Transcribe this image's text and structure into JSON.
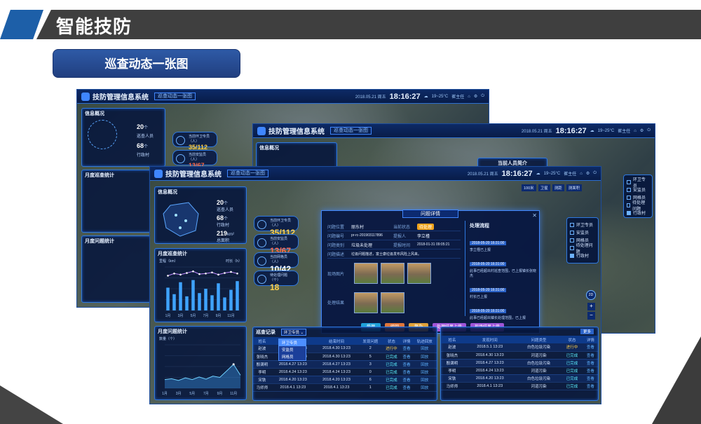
{
  "slide": {
    "title": "智能技防",
    "subtitle": "巡查动态一张图"
  },
  "app": {
    "system_title": "技防管理信息系统",
    "tag": "巡查动态一张图",
    "date": "2018.05.21 周五",
    "time": "18:16:27",
    "weather_temp": "19~25°C",
    "weather_desc": "小雨",
    "user": "崔主任"
  },
  "info_panel": {
    "title": "信息概况",
    "inspectors": "20",
    "inspectors_unit": "个",
    "inspectors_label": "巡查人员",
    "villages": "68",
    "villages_unit": "个",
    "villages_label": "行政村",
    "area": "219",
    "area_unit": "km²",
    "area_label": "总面积"
  },
  "stats": [
    {
      "label": "当前环卫专员（人）",
      "value": "35/112",
      "color": "yellow"
    },
    {
      "label": "当前安监员（人）",
      "value": "13/67",
      "color": "red"
    },
    {
      "label": "当前网格员（人）",
      "value": "10/42",
      "color": "white"
    },
    {
      "label": "待处理问题（个）",
      "value": "18",
      "color": "yellow"
    }
  ],
  "monthly_chart": {
    "title": "月度巡查统计",
    "y_left": "里程（km）",
    "y_right": "时长（h）",
    "months": [
      "1月",
      "2月",
      "3月",
      "4月",
      "5月",
      "6月"
    ]
  },
  "problem_chart": {
    "title": "月度问题统计",
    "y_label": "数量（个）",
    "y_ticks": [
      "100",
      "80",
      "60",
      "40",
      "20",
      "0"
    ]
  },
  "chart_data": [
    {
      "type": "bar",
      "title": "月度巡查统计",
      "categories": [
        "1月",
        "2月",
        "3月",
        "4月",
        "5月",
        "6月",
        "7月",
        "8月",
        "9月",
        "10月",
        "11月",
        "12月"
      ],
      "series": [
        {
          "name": "里程",
          "values": [
            210,
            150,
            260,
            130,
            280,
            160,
            200,
            140,
            250,
            120,
            190,
            270
          ]
        },
        {
          "name": "时长",
          "values": [
            320,
            340,
            330,
            345,
            360,
            335,
            340,
            350,
            330,
            345,
            355,
            340
          ]
        }
      ],
      "xlabel": "",
      "ylabel": "里程（km）",
      "ylim": [
        0,
        400
      ]
    },
    {
      "type": "area",
      "title": "月度问题统计",
      "categories": [
        "1月",
        "2月",
        "3月",
        "4月",
        "5月",
        "6月",
        "7月",
        "8月",
        "9月",
        "10月",
        "11月",
        "12月"
      ],
      "values": [
        20,
        22,
        18,
        24,
        20,
        26,
        21,
        28,
        25,
        40,
        55,
        30
      ],
      "ylabel": "数量（个）",
      "ylim": [
        0,
        100
      ]
    }
  ],
  "problem_modal": {
    "title": "问题详情",
    "fields": [
      {
        "k": "问题位置",
        "v": "丽东村",
        "k2": "当前状态",
        "v2": "待处理"
      },
      {
        "k": "问题编号",
        "v": "pr-rc-201903117896",
        "k2": "提报人",
        "v2": "李立槿"
      },
      {
        "k": "问题类别",
        "v": "垃圾未处理",
        "k2": "提报时间",
        "v2": "2018-01-31 09:05:21"
      },
      {
        "k": "问题描述",
        "v": "垃圾问题描述，富士康垃圾发布风险上风来。",
        "k2": "",
        "v2": ""
      }
    ],
    "photos_label": "现场图片",
    "result_label": "处理结果",
    "flow_title": "处理流程",
    "flow": [
      {
        "time": "2018-05-20 16:31:00",
        "text": "李立槿已上报"
      },
      {
        "time": "2018-05-20 16:31:00",
        "text": "此事已经超出村巡查范围，已上报镇长张晓杰"
      },
      {
        "time": "2018-05-20 16:31:00",
        "text": "村长已上报"
      },
      {
        "time": "2018-05-20 16:31:00",
        "text": "此事已经超出镇长处理范围，已上报"
      }
    ],
    "buttons": [
      "受理",
      "驳回",
      "督办",
      "处理结果上传",
      "现场结果上传"
    ]
  },
  "patrol_table": {
    "title": "巡查记录",
    "dropdown": "环卫专员",
    "dropdown_options": [
      "环卫专员",
      "安监员",
      "网格员"
    ],
    "headers": [
      "姓名",
      "开始时间",
      "结束时间",
      "发现问题",
      "状态",
      "详情",
      "轨迹回放"
    ],
    "rows": [
      [
        "赵波",
        "2018.4.30 13:23",
        "2018.4.30 13:23",
        "2",
        "进行中",
        "查看",
        "回放"
      ],
      [
        "张晓杰",
        "2018.4.30 13:23",
        "2018.4.30 13:23",
        "5",
        "已完成",
        "查看",
        "回放"
      ],
      [
        "殷满明",
        "2018.4.27 13:23",
        "2018.4.27 13:23",
        "3",
        "已完成",
        "查看",
        "回放"
      ],
      [
        "李明",
        "2018.4.24 13:23",
        "2018.4.24 13:23",
        "0",
        "已完成",
        "查看",
        "回放"
      ],
      [
        "宋铁",
        "2018.4.20 13:23",
        "2018.4.20 13:23",
        "6",
        "已完成",
        "查看",
        "回放"
      ],
      [
        "马师师",
        "2018.4.1 13:23",
        "2018.4.1 13:23",
        "1",
        "已完成",
        "查看",
        "回放"
      ]
    ]
  },
  "issue_table": {
    "more": "更多",
    "headers": [
      "姓名",
      "发现时间",
      "问题类型",
      "状态",
      "详情"
    ],
    "rows": [
      [
        "赵波",
        "2018.5.1 13:23",
        "白色垃圾污染",
        "进行中",
        "查看"
      ],
      [
        "张晓杰",
        "2018.4.30 13:23",
        "河道污染",
        "已完成",
        "查看"
      ],
      [
        "殷满明",
        "2018.4.27 13:23",
        "白色垃圾污染",
        "已完成",
        "查看"
      ],
      [
        "李明",
        "2018.4.24 13:23",
        "河道污染",
        "已完成",
        "查看"
      ],
      [
        "宋铁",
        "2018.4.20 13:23",
        "白色垃圾污染",
        "已完成",
        "查看"
      ],
      [
        "马师师",
        "2018.4.1 13:23",
        "河道污染",
        "已完成",
        "查看"
      ]
    ]
  },
  "filter": {
    "items": [
      "环卫专员",
      "安监员",
      "网格员",
      "待处理问题",
      "行政村"
    ],
    "checked": [
      false,
      false,
      false,
      false,
      true
    ]
  },
  "map_tools": {
    "scale": "100米",
    "b1": "卫星",
    "b2": "测距",
    "b3": "测面积",
    "zoom": "2D"
  },
  "popup_title": "当前人员简介"
}
